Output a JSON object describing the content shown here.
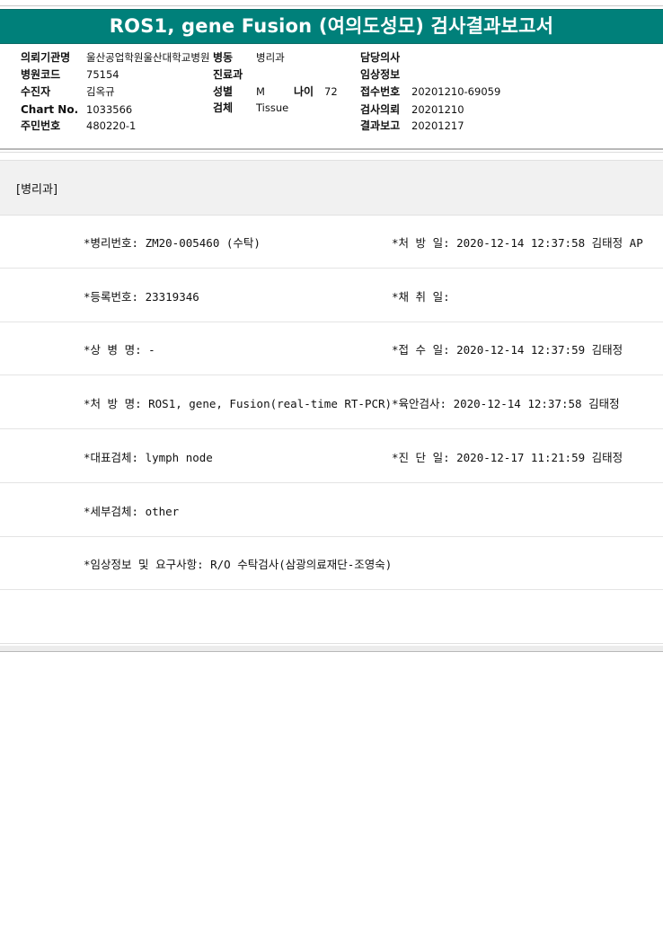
{
  "title": "ROS1, gene Fusion (여의도성모) 검사결과보고서",
  "header": {
    "institution_label": "의뢰기관명",
    "institution_value": "울산공업학원울산대학교병원",
    "ward_label": "병동",
    "ward_value": "병리과",
    "doctor_label": "담당의사",
    "doctor_value": "",
    "hospital_code_label": "병원코드",
    "hospital_code_value": "75154",
    "dept_label": "진료과",
    "dept_value": "",
    "clinical_info_label": "임상정보",
    "clinical_info_value": "",
    "patient_label": "수진자",
    "patient_value": "김옥규",
    "sex_label": "성별",
    "sex_value": "M",
    "age_label": "나이",
    "age_value": "72",
    "receipt_no_label": "접수번호",
    "receipt_no_value": "20201210-69059",
    "chart_label": "Chart No.",
    "chart_value": "1033566",
    "specimen_label": "검체",
    "specimen_value": "Tissue",
    "request_label": "검사의뢰",
    "request_value": "20201210",
    "rrn_label": "주민번호",
    "rrn_value": "480220-1",
    "report_label": "결과보고",
    "report_value": "20201217"
  },
  "section": {
    "dept_tag": "[병리과]"
  },
  "rows": [
    {
      "left": "*병리번호: ZM20-005460 (수탁)",
      "right": "*처 방 일: 2020-12-14 12:37:58  김태정 AP"
    },
    {
      "left": "*등록번호: 23319346",
      "right": "*채 취 일:"
    },
    {
      "left": "*상 병 명: -",
      "right": "*접 수 일: 2020-12-14 12:37:59  김태정"
    },
    {
      "left": "*처 방 명: ROS1, gene, Fusion(real-time RT-PCR)",
      "right": "*육안검사: 2020-12-14 12:37:58  김태정"
    },
    {
      "left": "*대표검체: lymph node",
      "right": "*진 단 일: 2020-12-17 11:21:59  김태정"
    },
    {
      "left": "*세부검체: other",
      "right": ""
    },
    {
      "left": "*임상정보 및 요구사항: R/O 수탁검사(삼광의료재단-조영숙)",
      "right": ""
    },
    {
      "left": "",
      "right": ""
    }
  ]
}
